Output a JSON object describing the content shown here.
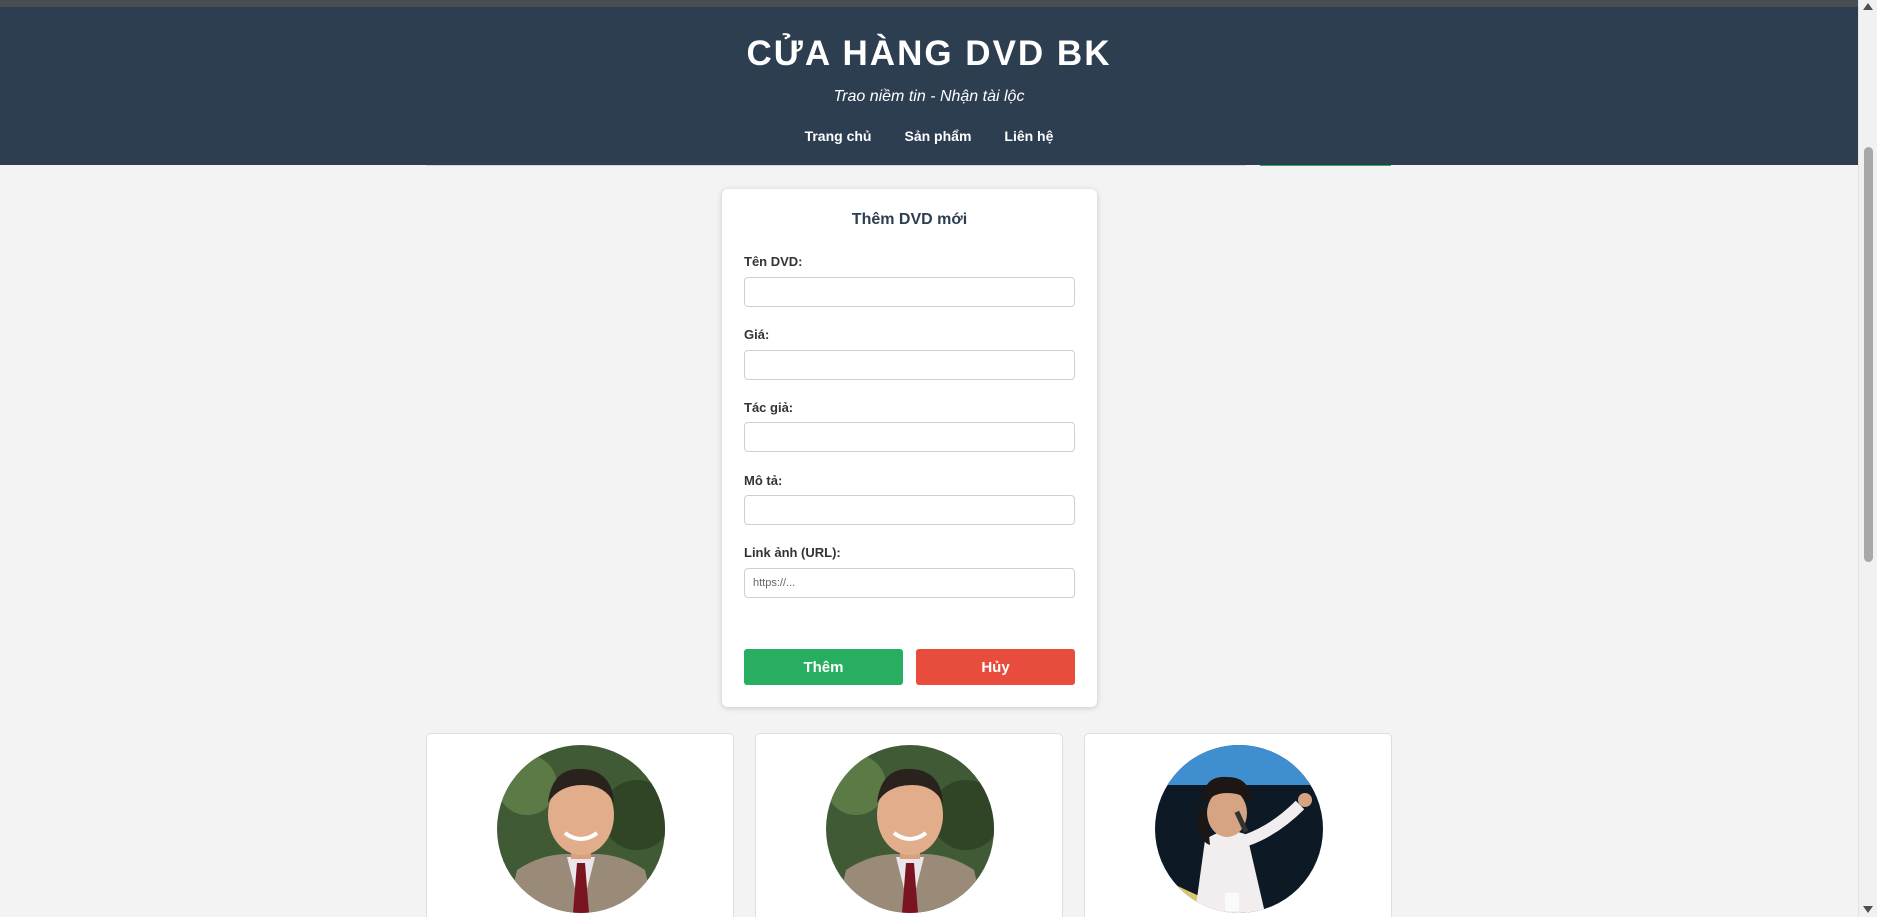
{
  "header": {
    "title": "CỬA HÀNG DVD BK",
    "slogan": "Trao niềm tin - Nhận tài lộc",
    "nav": [
      "Trang chủ",
      "Sản phẩm",
      "Liên hệ"
    ]
  },
  "form": {
    "title": "Thêm DVD mới",
    "fields": [
      {
        "label": "Tên DVD:",
        "value": "",
        "placeholder": ""
      },
      {
        "label": "Giá:",
        "value": "",
        "placeholder": ""
      },
      {
        "label": "Tác giả:",
        "value": "",
        "placeholder": ""
      },
      {
        "label": "Mô tả:",
        "value": "",
        "placeholder": ""
      },
      {
        "label": "Link ảnh (URL):",
        "value": "",
        "placeholder": "https://..."
      }
    ],
    "submit_label": "Thêm",
    "cancel_label": "Hủy"
  },
  "products": [
    {
      "image": "portrait-older-man-suit"
    },
    {
      "image": "portrait-older-man-suit"
    },
    {
      "image": "man-speaking-microphone"
    }
  ],
  "colors": {
    "header_bg": "#2c3e50",
    "page_bg": "#f3f3f3",
    "submit": "#27ae60",
    "cancel": "#e74c3c"
  }
}
